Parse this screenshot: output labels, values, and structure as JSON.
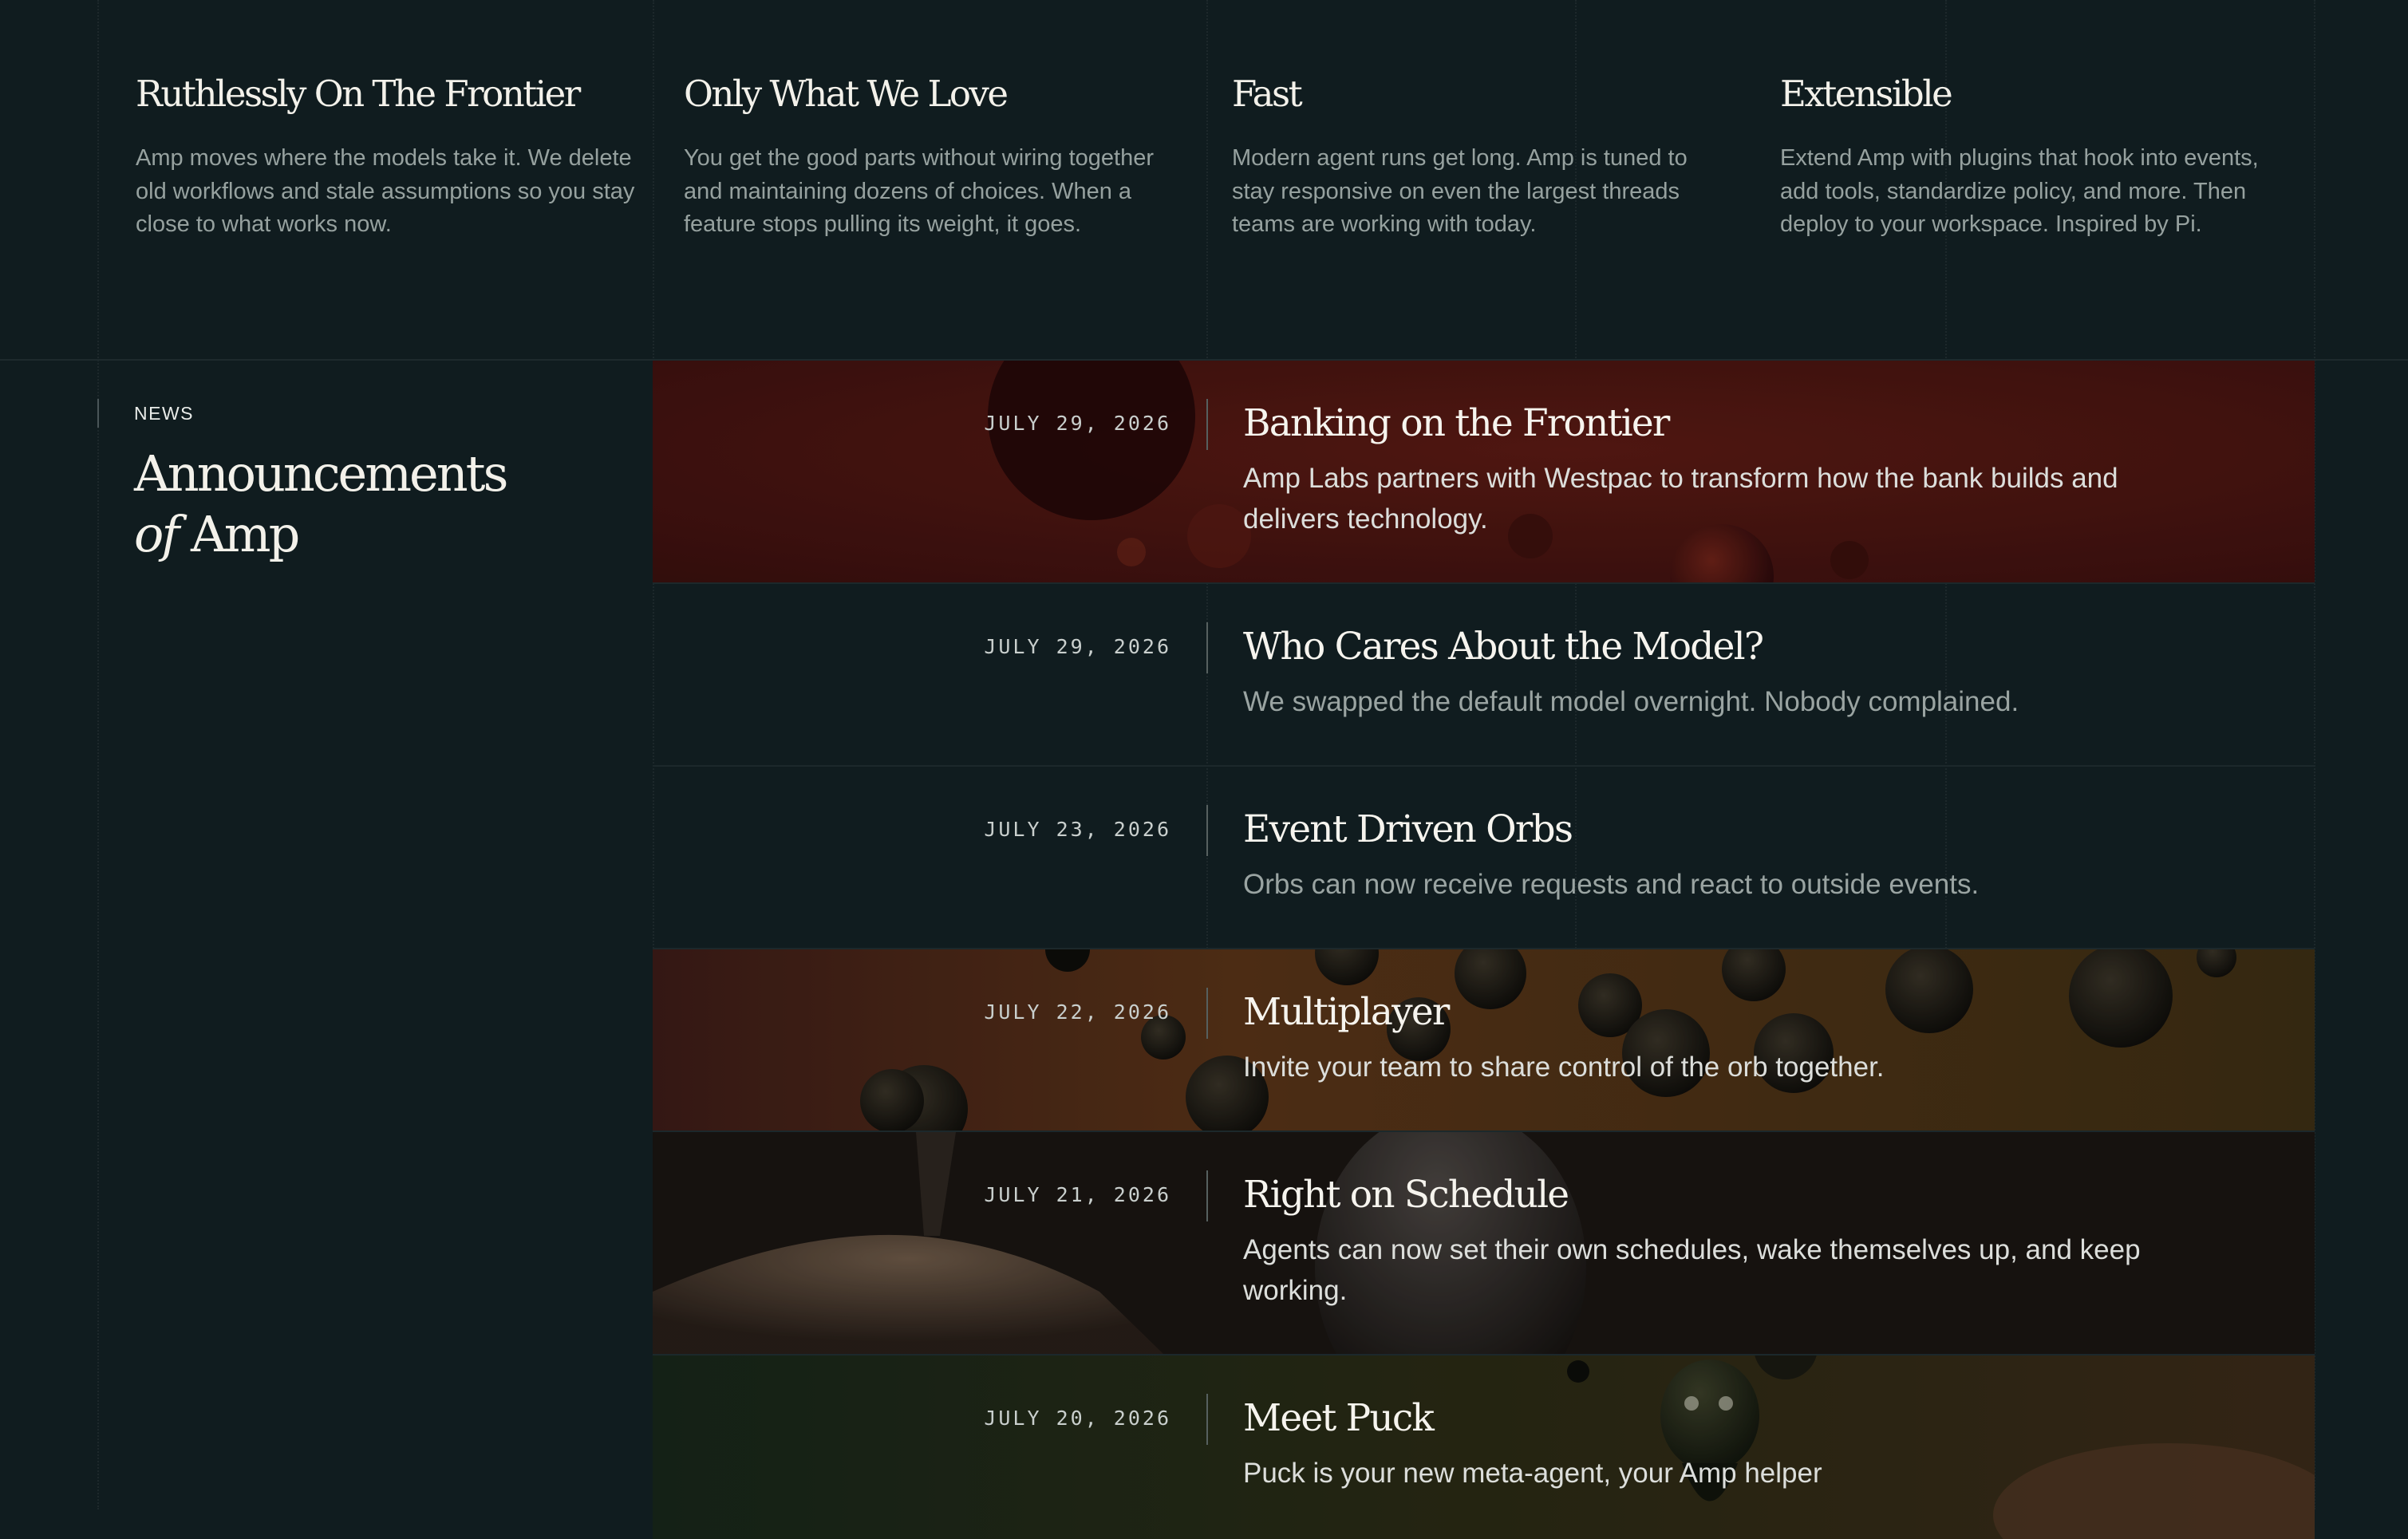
{
  "features": [
    {
      "title": "Ruthlessly On The Frontier",
      "body": "Amp moves where the models take it. We delete old workflows and stale assumptions so you stay close to what works now."
    },
    {
      "title": "Only What We Love",
      "body": "You get the good parts without wiring together and maintaining dozens of choices. When a feature stops pulling its weight, it goes."
    },
    {
      "title": "Fast",
      "body": "Modern agent runs get long. Amp is tuned to stay responsive on even the largest threads teams are working with today."
    },
    {
      "title": "Extensible",
      "body": "Extend Amp with plugins that hook into events, add tools, standardize policy, and more. Then deploy to your workspace. Inspired by Pi."
    }
  ],
  "news": {
    "label": "NEWS",
    "title_line1": "Announcements",
    "title_of": "of",
    "title_amp": "Amp",
    "items": [
      {
        "date": "JULY 29, 2026",
        "title": "Banking on the Frontier",
        "description": "Amp Labs partners with Westpac to transform how the bank builds and delivers technology."
      },
      {
        "date": "JULY 29, 2026",
        "title": "Who Cares About the Model?",
        "description": "We swapped the default model overnight. Nobody complained."
      },
      {
        "date": "JULY 23, 2026",
        "title": "Event Driven Orbs",
        "description": "Orbs can now receive requests and react to outside events."
      },
      {
        "date": "JULY 22, 2026",
        "title": "Multiplayer",
        "description": "Invite your team to share control of the orb together."
      },
      {
        "date": "JULY 21, 2026",
        "title": "Right on Schedule",
        "description": "Agents can now set their own schedules, wake themselves up, and keep working."
      },
      {
        "date": "JULY 20, 2026",
        "title": "Meet Puck",
        "description": "Puck is your new meta-agent, your Amp helper"
      }
    ]
  },
  "colors": {
    "background": "#101c1f",
    "heading": "#f3f1ea",
    "muted_text": "#96a19f",
    "banking_bg": "#4a1512",
    "multiplayer_bg": "#4a3418",
    "schedule_bg": "#1f1a16",
    "puck_bg": "#2a2a14"
  }
}
